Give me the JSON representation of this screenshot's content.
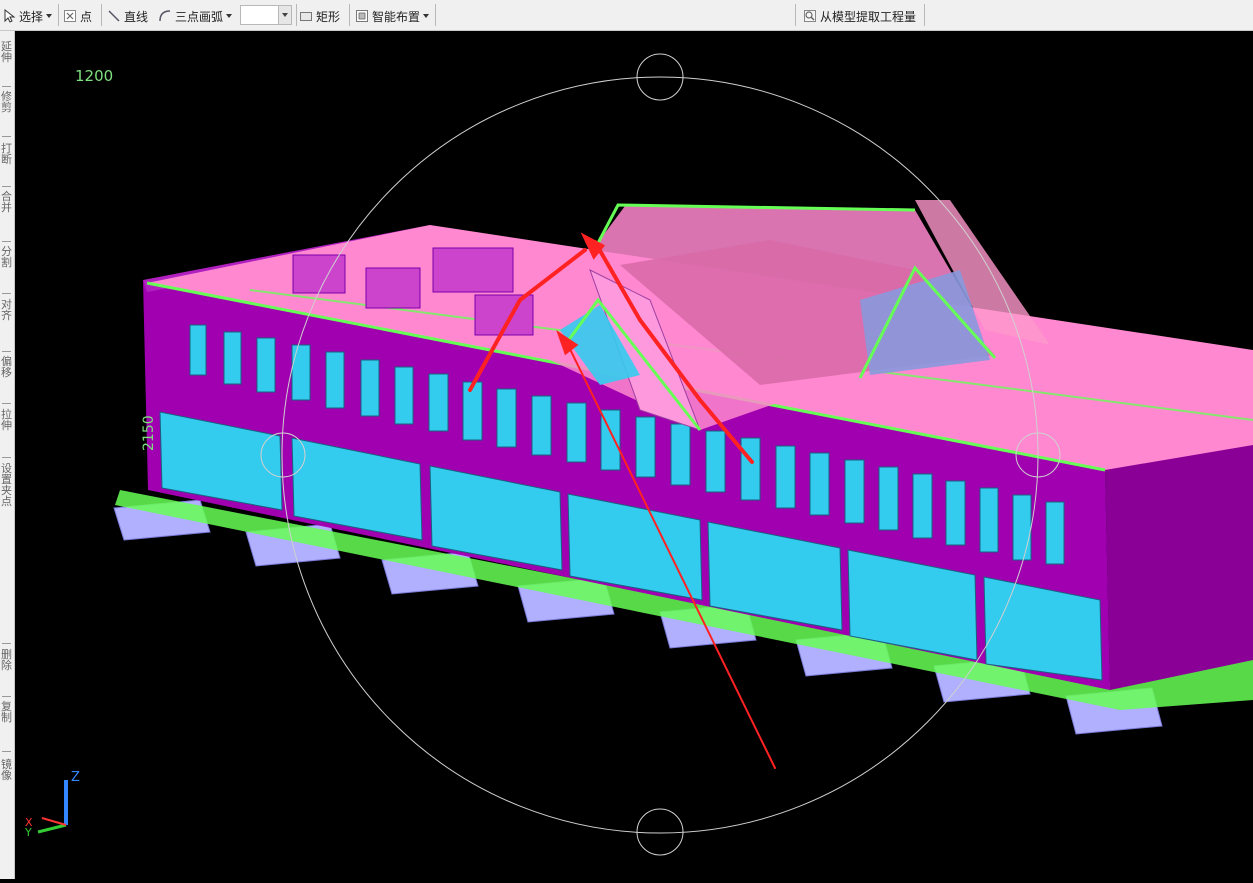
{
  "toolbar": {
    "select_label": "选择",
    "point_label": "点",
    "line_label": "直线",
    "arc_label": "三点画弧",
    "rect_label": "矩形",
    "smart_layout_label": "智能布置",
    "extract_label": "从模型提取工程量",
    "combo_value": ""
  },
  "sidebar": {
    "items": [
      "延伸",
      "修剪",
      "打断",
      "合并",
      "分割",
      "对齐",
      "偏移",
      "拉伸",
      "设置夹点",
      "删除",
      "复制",
      "镜像"
    ]
  },
  "viewport": {
    "dim_labels": [
      "1200",
      "2150"
    ],
    "axes": {
      "x": "X",
      "y": "Y",
      "z": "Z"
    }
  },
  "colors": {
    "background": "#000000",
    "wall": "#a000b0",
    "roof": "#ff99dd",
    "glass": "#33ccee",
    "slab": "#66ff55",
    "foundation": "#b0b0ff",
    "annotation": "#ff2222"
  },
  "icons": [
    "cursor-icon",
    "point-icon",
    "line-icon",
    "arc-icon",
    "rectangle-icon",
    "smart-layout-icon",
    "extract-icon"
  ]
}
